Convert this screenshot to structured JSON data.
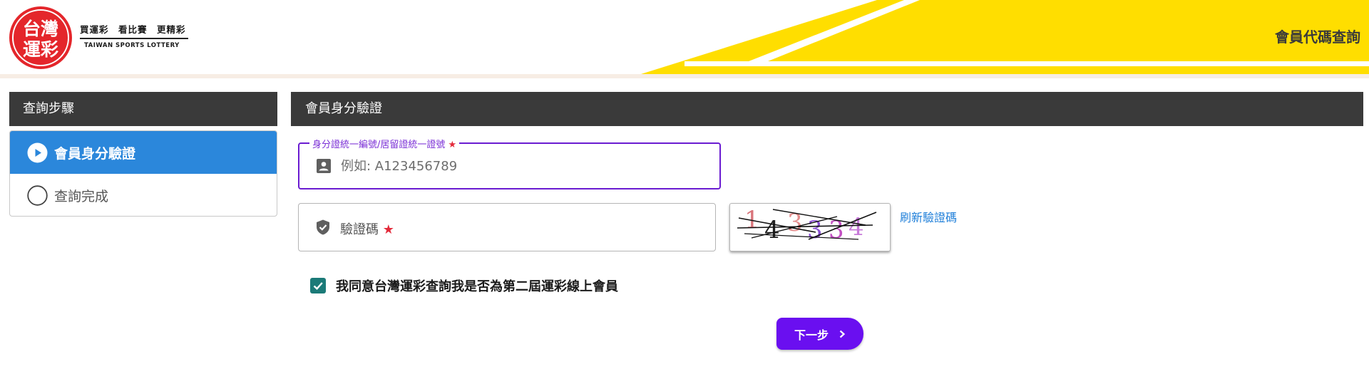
{
  "header": {
    "logo_text_line1": "台灣",
    "logo_text_line2": "運彩",
    "slogan_cn": "買運彩　看比賽　更精彩",
    "slogan_en": "TAIWAN SPORTS LOTTERY",
    "page_title": "會員代碼查詢",
    "brand_red": "#e4262b",
    "brand_yellow": "#ffde00"
  },
  "sidebar": {
    "title": "查詢步驟",
    "steps": [
      {
        "label": "會員身分驗證",
        "active": true,
        "icon": "play-circle-icon"
      },
      {
        "label": "查詢完成",
        "active": false,
        "icon": "empty-circle-icon"
      }
    ]
  },
  "main": {
    "title": "會員身分驗證",
    "id_field": {
      "label": "身分證統一編號/居留證統一證號",
      "required_mark": "★",
      "placeholder": "例如: A123456789",
      "value": "",
      "icon": "id-card-icon"
    },
    "captcha_field": {
      "label": "驗證碼",
      "required_mark": "★",
      "value": "",
      "icon": "shield-check-icon"
    },
    "captcha_image": {
      "digits": "143334"
    },
    "refresh_label": "刷新驗證碼",
    "agree": {
      "checked": true,
      "text": "我同意台灣運彩查詢我是否為第二屆運彩線上會員"
    },
    "next_button": {
      "label": "下一步",
      "icon": "chevron-right-icon",
      "color": "#6a0ff0"
    }
  }
}
